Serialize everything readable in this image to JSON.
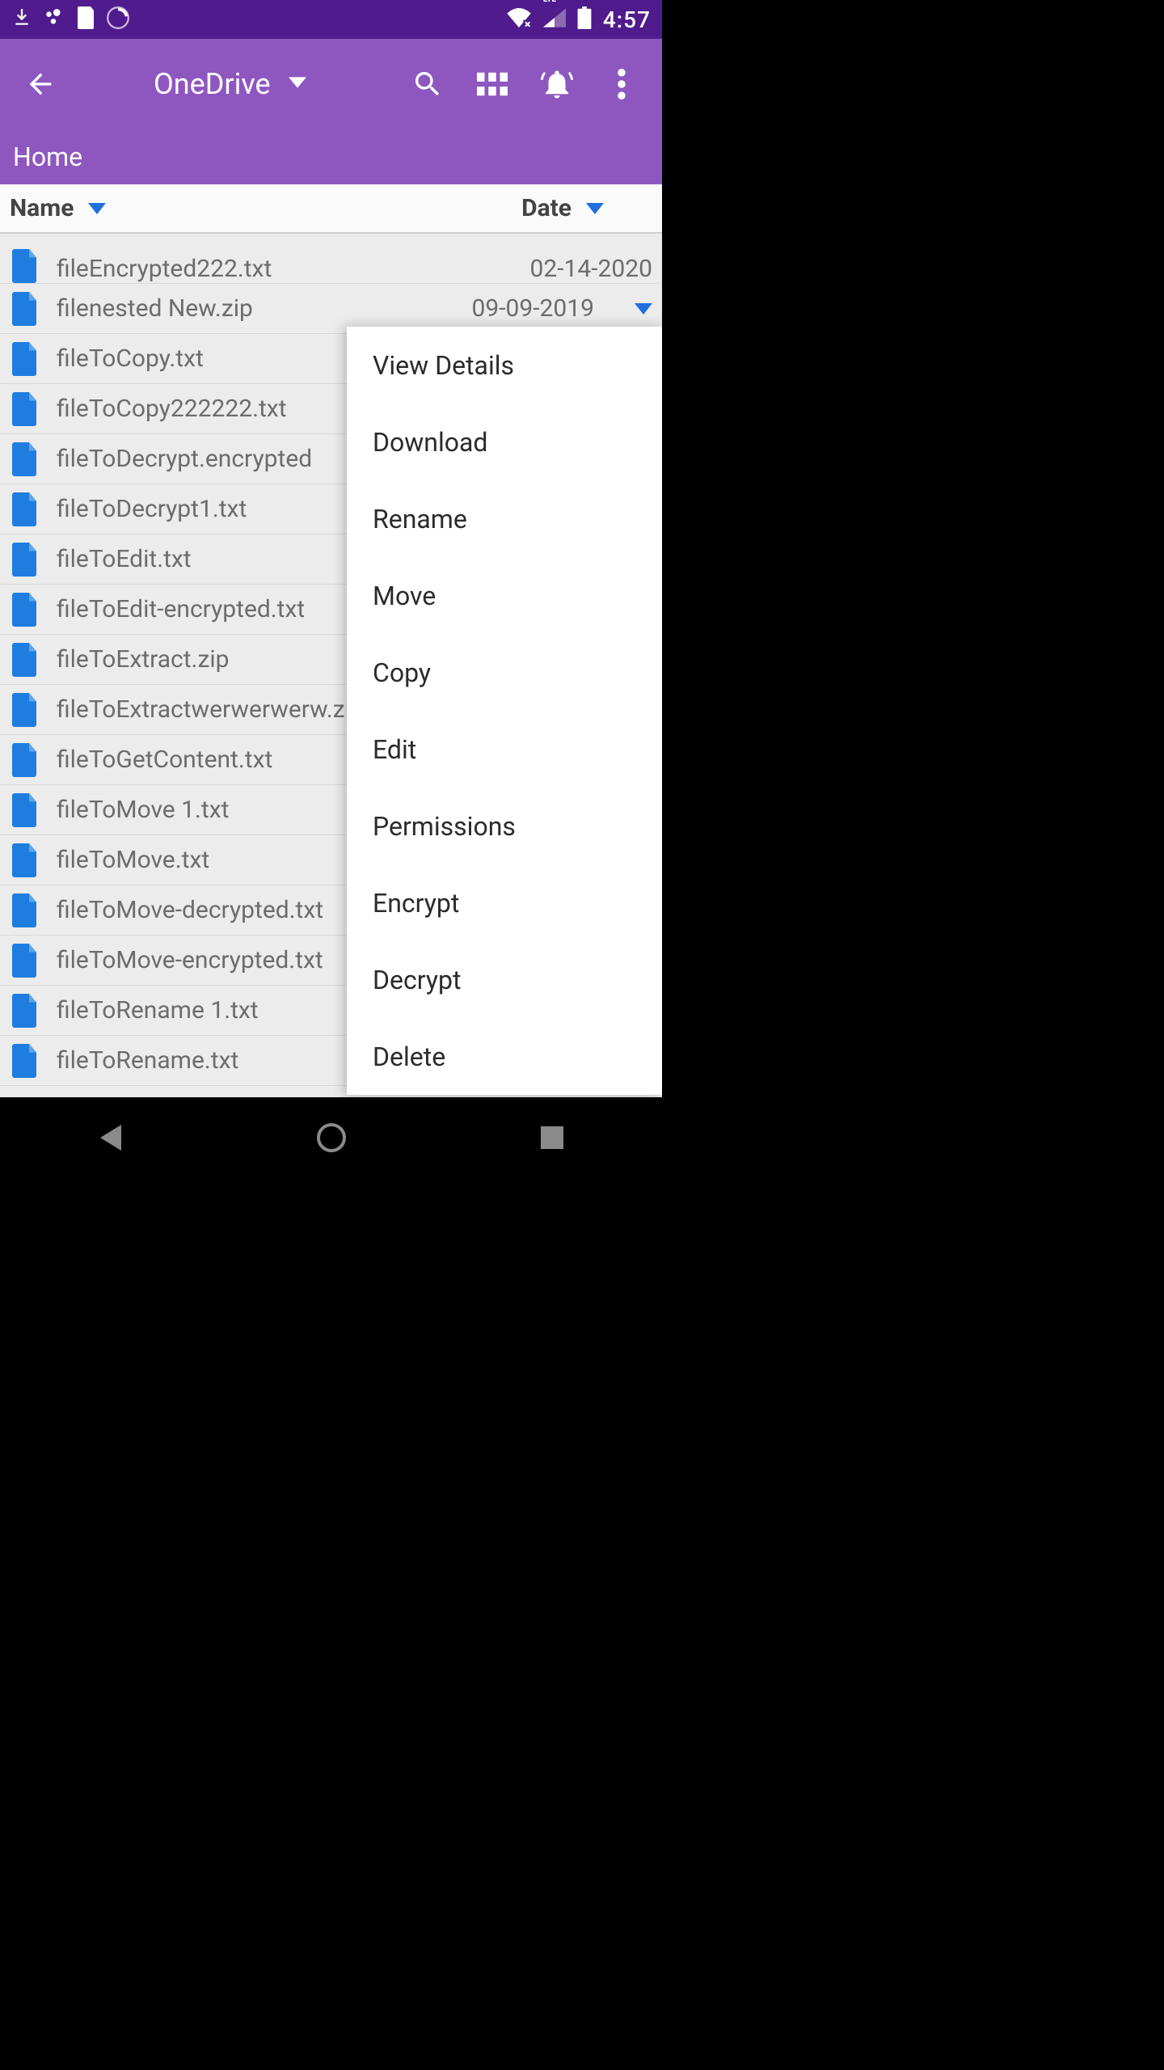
{
  "status": {
    "time": "4:57"
  },
  "appbar": {
    "title": "OneDrive"
  },
  "breadcrumb": {
    "path": "Home"
  },
  "sort": {
    "name_label": "Name",
    "date_label": "Date"
  },
  "files": [
    {
      "name": "fileEncrypted222.txt",
      "date": "02-14-2020",
      "partial_top": true
    },
    {
      "name": "filenested New.zip",
      "date": "09-09-2019",
      "show_arrow": true
    },
    {
      "name": "fileToCopy.txt",
      "date": ""
    },
    {
      "name": "fileToCopy222222.txt",
      "date": ""
    },
    {
      "name": "fileToDecrypt.encrypted",
      "date": ""
    },
    {
      "name": "fileToDecrypt1.txt",
      "date": ""
    },
    {
      "name": "fileToEdit.txt",
      "date": ""
    },
    {
      "name": "fileToEdit-encrypted.txt",
      "date": ""
    },
    {
      "name": "fileToExtract.zip",
      "date": ""
    },
    {
      "name": "fileToExtractwerwerwerw.zip",
      "date": ""
    },
    {
      "name": "fileToGetContent.txt",
      "date": ""
    },
    {
      "name": "fileToMove 1.txt",
      "date": ""
    },
    {
      "name": "fileToMove.txt",
      "date": ""
    },
    {
      "name": "fileToMove-decrypted.txt",
      "date": ""
    },
    {
      "name": "fileToMove-encrypted.txt",
      "date": ""
    },
    {
      "name": "fileToRename 1.txt",
      "date": ""
    },
    {
      "name": "fileToRename.txt",
      "date": ""
    }
  ],
  "menu": {
    "items": [
      "View Details",
      "Download",
      "Rename",
      "Move",
      "Copy",
      "Edit",
      "Permissions",
      "Encrypt",
      "Decrypt",
      "Delete"
    ]
  }
}
